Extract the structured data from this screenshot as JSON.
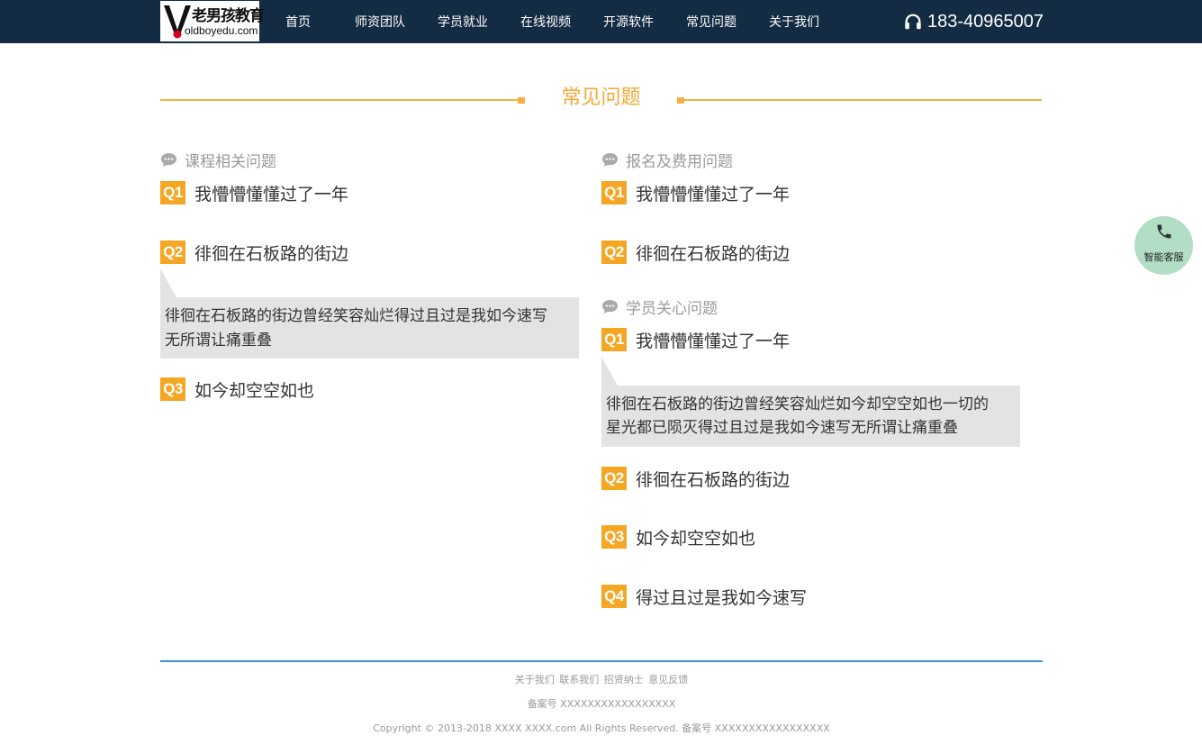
{
  "header": {
    "logo_cn": "老男孩教育",
    "logo_en": "oldboyedu.com",
    "nav": [
      "首页",
      "师资团队",
      "学员就业",
      "在线视频",
      "开源软件",
      "常见问题",
      "关于我们"
    ],
    "phone": "183-40965007"
  },
  "page_title": "常见问题",
  "sections": {
    "course": {
      "title": "课程相关问题",
      "items": [
        {
          "badge": "Q1",
          "question": "我懵懵懂懂过了一年"
        },
        {
          "badge": "Q2",
          "question": "徘徊在石板路的街边",
          "answer_lines": [
            "徘徊在石板路的街边曾经笑容灿烂得过且过是我如今速写",
            "无所谓让痛重叠"
          ]
        },
        {
          "badge": "Q3",
          "question": "如今却空空如也"
        }
      ]
    },
    "fees": {
      "title": "报名及费用问题",
      "items": [
        {
          "badge": "Q1",
          "question": "我懵懵懂懂过了一年"
        },
        {
          "badge": "Q2",
          "question": "徘徊在石板路的街边"
        }
      ]
    },
    "students": {
      "title": "学员关心问题",
      "items": [
        {
          "badge": "Q1",
          "question": "我懵懵懂懂过了一年",
          "answer_lines": [
            "徘徊在石板路的街边曾经笑容灿烂如今却空空如也一切的",
            "星光都已陨灭得过且过是我如今速写无所谓让痛重叠"
          ]
        },
        {
          "badge": "Q2",
          "question": "徘徊在石板路的街边"
        },
        {
          "badge": "Q3",
          "question": "如今却空空如也"
        },
        {
          "badge": "Q4",
          "question": "得过且过是我如今速写"
        }
      ]
    }
  },
  "service": {
    "label": "智能客服",
    "icon": "phone-icon"
  },
  "footer": {
    "links": [
      "关于我们",
      "联系我们",
      "招贤纳士",
      "意见反馈"
    ],
    "icp": "备案号 XXXXXXXXXXXXXXXXX",
    "copyright": "Copyright © 2013-2018 XXXX XXXX.com All Rights Reserved. 备案号 XXXXXXXXXXXXXXXXX"
  },
  "colors": {
    "header_bg": "#132b43",
    "accent": "#f5a623",
    "footer_line": "#3b8fe0",
    "service_bg": "#b1dec5"
  }
}
